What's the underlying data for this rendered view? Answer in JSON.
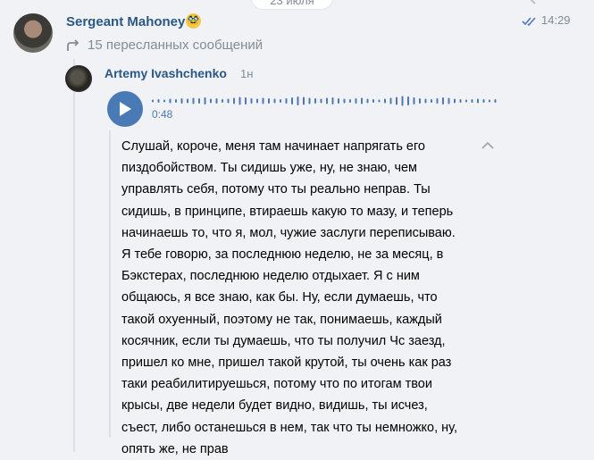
{
  "header": {
    "date_label": "23 июля"
  },
  "message": {
    "sender": "Sergeant Mahoney",
    "sender_badge": "🥸",
    "time": "14:29",
    "forwarded_count_label": "15 пересланных сообщений"
  },
  "forwarded": {
    "sender": "Artemy Ivashchenko",
    "time": "1н",
    "voice": {
      "duration": "0:48",
      "icon": "play-icon",
      "accent_color": "#4a7ab5"
    },
    "transcript_lines": [
      "Слушай, короче, меня там начинает напрягать его",
      "пиздобойством. Ты сидишь уже, ну, не знаю, чем",
      "управлять себя, потому что ты реально неправ. Ты",
      "сидишь, в принципе, втираешь какую то мазу, и теперь",
      "начинаешь то, что я, мол, чужие заслуги переписываю.",
      "Я тебе говорю, за последнюю неделю, не за месяц, в",
      "Бэкстерах, последнюю неделю отдыхает. Я с ним",
      "общаюсь, я все знаю, как бы. Ну, если думаешь, что",
      "такой охуенный, поэтому не так, понимаешь, каждый",
      "косячник, если ты думаешь, что ты получил Чс заезд,",
      "пришел ко мне, пришел такой крутой, ты очень как раз",
      "таки реабилитируешься, потому что по итогам твои",
      "крысы, две недели будет видно, видишь, ты исчез,",
      "съест, либо останешься в нем, так что ты немножко, ну,",
      "опять же, не прав"
    ]
  },
  "colors": {
    "link": "#2a5885",
    "muted": "#818c99",
    "background": "#f0f2f5"
  }
}
